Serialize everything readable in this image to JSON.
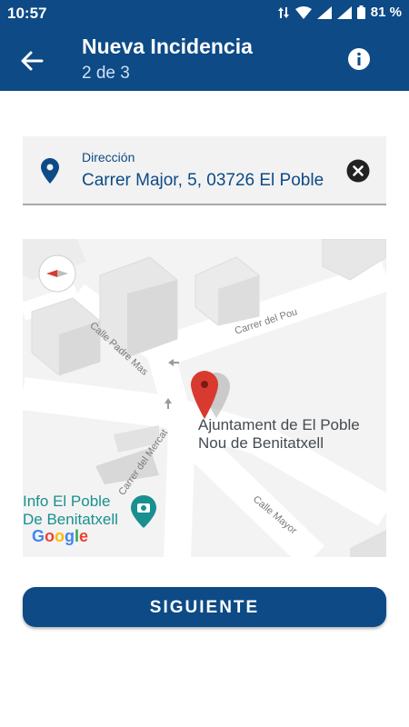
{
  "status_bar": {
    "time": "10:57",
    "battery": "81 %"
  },
  "app_bar": {
    "title": "Nueva Incidencia",
    "subtitle": "2 de 3"
  },
  "address": {
    "label": "Dirección",
    "value": "Carrer Major, 5, 03726 El Poble"
  },
  "map": {
    "streets": [
      "Carrer del Pou",
      "Calle Padre Mas",
      "Carrer del Mercat",
      "Calle Mayor"
    ],
    "poi_name_line1": "Ajuntament de El Poble",
    "poi_name_line2": "Nou de Benitatxell",
    "poi2_line1": "Info El Poble",
    "poi2_line2": "De Benitatxell",
    "attribution": "Google"
  },
  "actions": {
    "next_label": "SIGUIENTE"
  },
  "colors": {
    "primary": "#0d4a86",
    "marker": "#d93a2f",
    "poi2": "#1a8f8f"
  }
}
